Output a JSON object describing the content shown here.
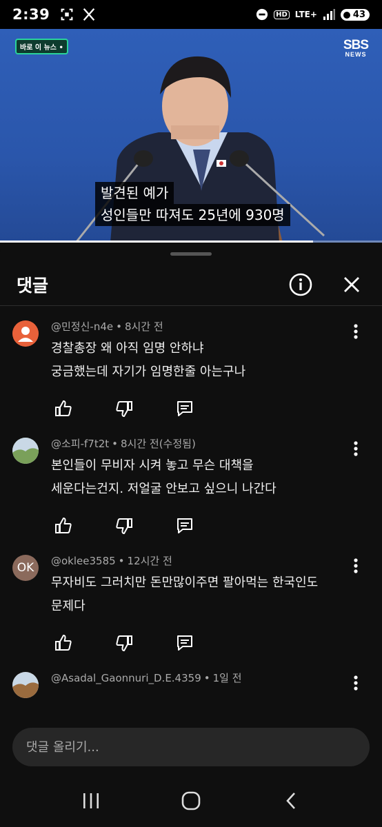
{
  "status_bar": {
    "time": "2:39",
    "network": "LTE+",
    "hd": "HD",
    "battery": "43",
    "icons": [
      "screenshot-icon",
      "x-app-icon",
      "dnd-icon",
      "hd-voice-icon",
      "lte-icon",
      "signal-icon",
      "battery-icon"
    ]
  },
  "video": {
    "badge": "바로 이 뉴스 •",
    "logo_main": "SBS",
    "logo_sub": "NEWS",
    "caption_line1": "발견된 예가",
    "caption_line2": "성인들만 따져도 25년에 930명",
    "progress_fraction": 0.82
  },
  "panel": {
    "title": "댓글",
    "info_icon": "info-icon",
    "close_icon": "close-icon"
  },
  "comments": [
    {
      "author": "@민정신-n4e",
      "time": "8시간 전",
      "text": "경찰총장  왜 아직 임명 안하냐\n궁금했는데 자기가 임명한줄 아는구나",
      "avatar_type": "default",
      "avatar_color": "#e8613a"
    },
    {
      "author": "@소피-f7t2t",
      "time": "8시간 전(수정됨)",
      "text": "본인들이 무비자 시켜 놓고 무슨 대책을\n세운다는건지. 저얼굴 안보고 싶으니 나간다",
      "avatar_type": "photo",
      "avatar_color": "#7aa05a"
    },
    {
      "author": "@oklee3585",
      "time": "12시간 전",
      "text": "무자비도 그러치만 돈만많이주면 팔아먹는 한국인도\n문제다",
      "avatar_type": "initials",
      "avatar_initials": "OK",
      "avatar_color": "#8b6a5c"
    },
    {
      "author": "@Asadal_Gaonnuri_D.E.4359",
      "time": "1일 전",
      "text": "",
      "avatar_type": "photo",
      "avatar_color": "#9a6b3e"
    }
  ],
  "input": {
    "placeholder": "댓글 올리기..."
  },
  "nav": {
    "recent_icon": "recent-apps-icon",
    "home_icon": "home-icon",
    "back_icon": "back-icon"
  }
}
